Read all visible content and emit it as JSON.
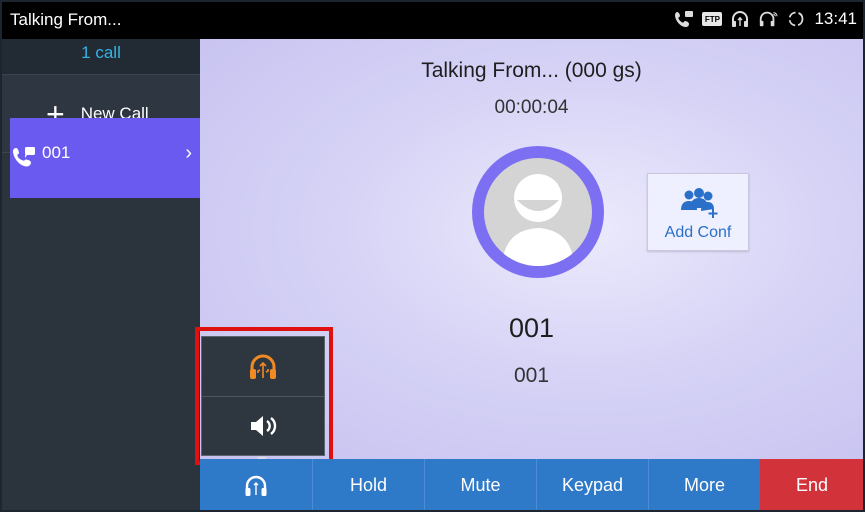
{
  "statusbar": {
    "title": "Talking From...",
    "time": "13:41",
    "icons": [
      "call-forward-icon",
      "ftp-icon",
      "usb-headset-icon",
      "wifi-headset-icon",
      "sync-icon"
    ],
    "ftp_label": "FTP"
  },
  "sidebar": {
    "call_count": "1 call",
    "new_call_label": "New Call",
    "active_line": {
      "number": "001"
    }
  },
  "call": {
    "title": "Talking From... (000 gs)",
    "timer": "00:00:04",
    "callee_name": "001",
    "callee_number": "001",
    "add_conf_label": "Add Conf"
  },
  "audio_popup": {
    "options": [
      "usb-headset-icon",
      "speaker-icon"
    ]
  },
  "bottombar": {
    "hold": "Hold",
    "mute": "Mute",
    "keypad": "Keypad",
    "more": "More",
    "end": "End"
  },
  "colors": {
    "accent_purple": "#6a5af0",
    "button_blue": "#2f79c9",
    "end_red": "#d2333b",
    "headset_orange": "#f08a24",
    "highlight_red": "#e01010"
  }
}
